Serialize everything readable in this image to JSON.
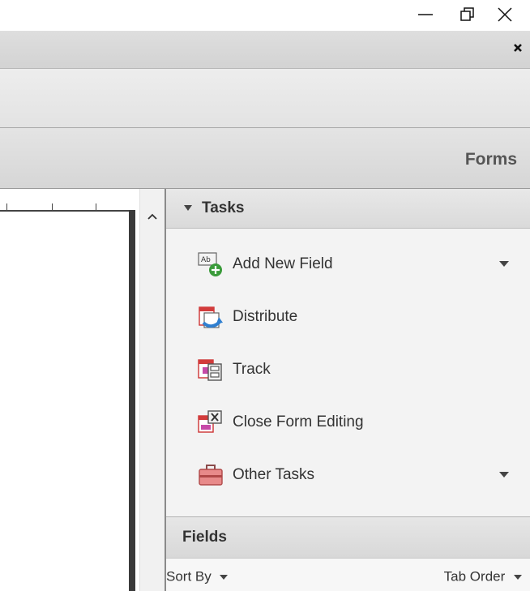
{
  "window": {
    "minimize_icon": "minimize-icon",
    "restore_icon": "restore-icon",
    "close_icon": "close-icon"
  },
  "message_bar": {
    "close_icon": "close-x-icon"
  },
  "task_bar": {
    "label": "Forms"
  },
  "tasks_panel": {
    "title": "Tasks",
    "items": [
      {
        "label": "Add New Field",
        "icon": "add-field-icon",
        "has_dropdown": true
      },
      {
        "label": "Distribute",
        "icon": "distribute-icon",
        "has_dropdown": false
      },
      {
        "label": "Track",
        "icon": "track-icon",
        "has_dropdown": false
      },
      {
        "label": "Close Form Editing",
        "icon": "close-form-editing-icon",
        "has_dropdown": false
      },
      {
        "label": "Other Tasks",
        "icon": "toolbox-icon",
        "has_dropdown": true
      }
    ]
  },
  "fields_panel": {
    "title": "Fields",
    "sort_by_label": "Sort By",
    "tab_order_label": "Tab Order"
  },
  "colors": {
    "pane_bg": "#f3f3f3",
    "header_bg": "#dadada",
    "accent_green": "#3a9b3a",
    "accent_red": "#d23b3b",
    "accent_blue": "#2f7fd0"
  }
}
